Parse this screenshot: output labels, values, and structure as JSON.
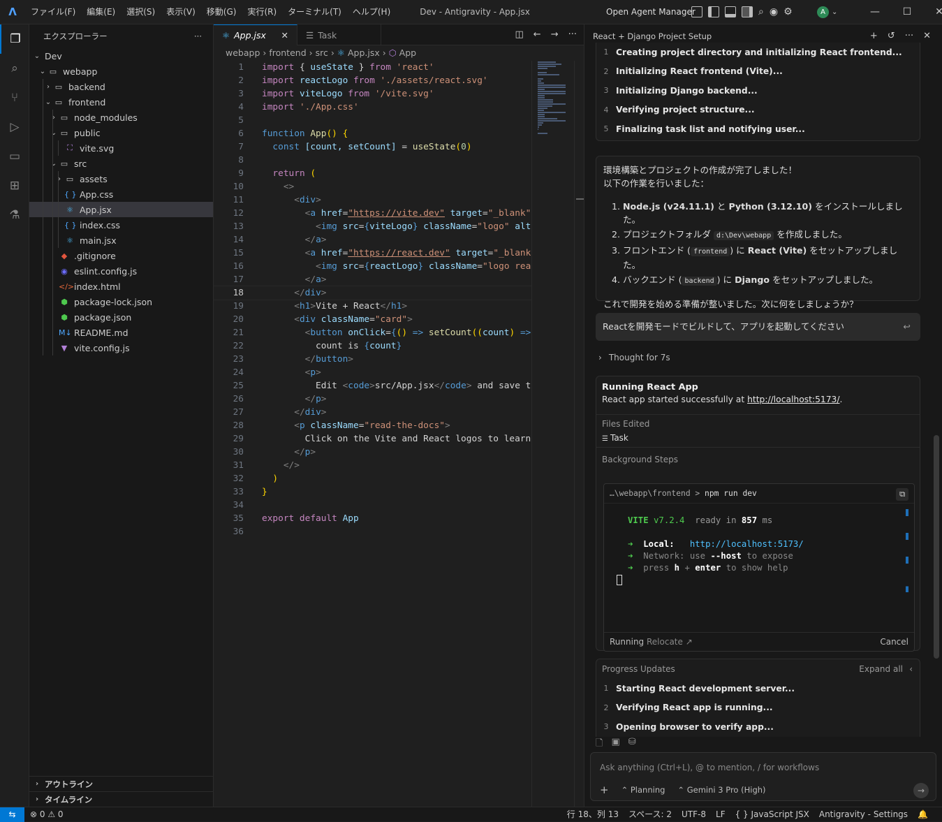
{
  "titlebar": {
    "menus": [
      "ファイル(F)",
      "編集(E)",
      "選択(S)",
      "表示(V)",
      "移動(G)",
      "実行(R)",
      "ターミナル(T)",
      "ヘルプ(H)"
    ],
    "title": "Dev - Antigravity - App.jsx",
    "agent_manager": "Open Agent Manager",
    "avatar": "A",
    "brand_color": "#0078d4"
  },
  "sidebar": {
    "title": "エクスプローラー",
    "root": "Dev",
    "items": [
      {
        "label": "webapp",
        "depth": 1,
        "chev": "v",
        "icon": "folder"
      },
      {
        "label": "backend",
        "depth": 2,
        "chev": ">",
        "icon": "folder"
      },
      {
        "label": "frontend",
        "depth": 2,
        "chev": "v",
        "icon": "folder"
      },
      {
        "label": "node_modules",
        "depth": 3,
        "chev": ">",
        "icon": "folder"
      },
      {
        "label": "public",
        "depth": 3,
        "chev": "v",
        "icon": "folder"
      },
      {
        "label": "vite.svg",
        "depth": 4,
        "chev": "",
        "icon": "svg"
      },
      {
        "label": "src",
        "depth": 3,
        "chev": "v",
        "icon": "folder"
      },
      {
        "label": "assets",
        "depth": 4,
        "chev": ">",
        "icon": "folder"
      },
      {
        "label": "App.css",
        "depth": 4,
        "chev": "",
        "icon": "css"
      },
      {
        "label": "App.jsx",
        "depth": 4,
        "chev": "",
        "icon": "react",
        "selected": true
      },
      {
        "label": "index.css",
        "depth": 4,
        "chev": "",
        "icon": "css"
      },
      {
        "label": "main.jsx",
        "depth": 4,
        "chev": "",
        "icon": "react"
      },
      {
        "label": ".gitignore",
        "depth": 3,
        "chev": "",
        "icon": "git"
      },
      {
        "label": "eslint.config.js",
        "depth": 3,
        "chev": "",
        "icon": "eslint"
      },
      {
        "label": "index.html",
        "depth": 3,
        "chev": "",
        "icon": "html"
      },
      {
        "label": "package-lock.json",
        "depth": 3,
        "chev": "",
        "icon": "npm"
      },
      {
        "label": "package.json",
        "depth": 3,
        "chev": "",
        "icon": "npm"
      },
      {
        "label": "README.md",
        "depth": 3,
        "chev": "",
        "icon": "md"
      },
      {
        "label": "vite.config.js",
        "depth": 3,
        "chev": "",
        "icon": "vite"
      }
    ],
    "outline": "アウトライン",
    "timeline": "タイムライン"
  },
  "editor": {
    "tabs": [
      {
        "label": "App.jsx",
        "active": true
      },
      {
        "label": "Task",
        "active": false
      }
    ],
    "breadcrumb": [
      "webapp",
      "frontend",
      "src",
      "App.jsx",
      "App"
    ],
    "current_line": 18,
    "lines": [
      [
        [
          "kw",
          "import "
        ],
        [
          "w",
          "{ "
        ],
        [
          "v",
          "useState"
        ],
        [
          "w",
          " } "
        ],
        [
          "kw",
          "from "
        ],
        [
          "s",
          "'react'"
        ]
      ],
      [
        [
          "kw",
          "import "
        ],
        [
          "v",
          "reactLogo "
        ],
        [
          "kw",
          "from "
        ],
        [
          "s",
          "'./assets/react.svg'"
        ]
      ],
      [
        [
          "kw",
          "import "
        ],
        [
          "v",
          "viteLogo "
        ],
        [
          "kw",
          "from "
        ],
        [
          "s",
          "'/vite.svg'"
        ]
      ],
      [
        [
          "kw",
          "import "
        ],
        [
          "s",
          "'./App.css'"
        ]
      ],
      [],
      [
        [
          "k",
          "function "
        ],
        [
          "f",
          "App"
        ],
        [
          "br",
          "() {"
        ]
      ],
      [
        [
          "w",
          "  "
        ],
        [
          "k",
          "const "
        ],
        [
          "v",
          "[count, setCount]"
        ],
        [
          "w",
          " = "
        ],
        [
          "f",
          "useState"
        ],
        [
          "br",
          "("
        ],
        [
          "n",
          "0"
        ],
        [
          "br",
          ")"
        ]
      ],
      [],
      [
        [
          "w",
          "  "
        ],
        [
          "kw",
          "return "
        ],
        [
          "br",
          "("
        ]
      ],
      [
        [
          "w",
          "    "
        ],
        [
          "p",
          "<>"
        ]
      ],
      [
        [
          "w",
          "      "
        ],
        [
          "p",
          "<"
        ],
        [
          "t",
          "div"
        ],
        [
          "p",
          ">"
        ]
      ],
      [
        [
          "w",
          "        "
        ],
        [
          "p",
          "<"
        ],
        [
          "t",
          "a "
        ],
        [
          "a",
          "href"
        ],
        [
          "w",
          "="
        ],
        [
          "u",
          "\"https://vite.dev\""
        ],
        [
          "w",
          " "
        ],
        [
          "a",
          "target"
        ],
        [
          "w",
          "="
        ],
        [
          "s",
          "\"_blank\""
        ]
      ],
      [
        [
          "w",
          "          "
        ],
        [
          "p",
          "<"
        ],
        [
          "t",
          "img "
        ],
        [
          "a",
          "src"
        ],
        [
          "w",
          "="
        ],
        [
          "k",
          "{"
        ],
        [
          "v",
          "viteLogo"
        ],
        [
          "k",
          "}"
        ],
        [
          "w",
          " "
        ],
        [
          "a",
          "className"
        ],
        [
          "w",
          "="
        ],
        [
          "s",
          "\"logo\""
        ],
        [
          "w",
          " "
        ],
        [
          "a",
          "alt"
        ]
      ],
      [
        [
          "w",
          "        "
        ],
        [
          "p",
          "</"
        ],
        [
          "t",
          "a"
        ],
        [
          "p",
          ">"
        ]
      ],
      [
        [
          "w",
          "        "
        ],
        [
          "p",
          "<"
        ],
        [
          "t",
          "a "
        ],
        [
          "a",
          "href"
        ],
        [
          "w",
          "="
        ],
        [
          "u",
          "\"https://react.dev\""
        ],
        [
          "w",
          " "
        ],
        [
          "a",
          "target"
        ],
        [
          "w",
          "="
        ],
        [
          "s",
          "\"_blank"
        ]
      ],
      [
        [
          "w",
          "          "
        ],
        [
          "p",
          "<"
        ],
        [
          "t",
          "img "
        ],
        [
          "a",
          "src"
        ],
        [
          "w",
          "="
        ],
        [
          "k",
          "{"
        ],
        [
          "v",
          "reactLogo"
        ],
        [
          "k",
          "}"
        ],
        [
          "w",
          " "
        ],
        [
          "a",
          "className"
        ],
        [
          "w",
          "="
        ],
        [
          "s",
          "\"logo rea"
        ]
      ],
      [
        [
          "w",
          "        "
        ],
        [
          "p",
          "</"
        ],
        [
          "t",
          "a"
        ],
        [
          "p",
          ">"
        ]
      ],
      [
        [
          "w",
          "      "
        ],
        [
          "p",
          "</"
        ],
        [
          "t",
          "div"
        ],
        [
          "p",
          ">"
        ]
      ],
      [
        [
          "w",
          "      "
        ],
        [
          "p",
          "<"
        ],
        [
          "t",
          "h1"
        ],
        [
          "p",
          ">"
        ],
        [
          "w",
          "Vite + React"
        ],
        [
          "p",
          "</"
        ],
        [
          "t",
          "h1"
        ],
        [
          "p",
          ">"
        ]
      ],
      [
        [
          "w",
          "      "
        ],
        [
          "p",
          "<"
        ],
        [
          "t",
          "div "
        ],
        [
          "a",
          "className"
        ],
        [
          "w",
          "="
        ],
        [
          "s",
          "\"card\""
        ],
        [
          "p",
          ">"
        ]
      ],
      [
        [
          "w",
          "        "
        ],
        [
          "p",
          "<"
        ],
        [
          "t",
          "button "
        ],
        [
          "a",
          "onClick"
        ],
        [
          "w",
          "="
        ],
        [
          "k",
          "{"
        ],
        [
          "br",
          "() "
        ],
        [
          "k",
          "=> "
        ],
        [
          "f",
          "setCount"
        ],
        [
          "br",
          "(("
        ],
        [
          "v",
          "count"
        ],
        [
          "br",
          ") "
        ],
        [
          "k",
          "=>"
        ]
      ],
      [
        [
          "w",
          "          count is "
        ],
        [
          "k",
          "{"
        ],
        [
          "v",
          "count"
        ],
        [
          "k",
          "}"
        ]
      ],
      [
        [
          "w",
          "        "
        ],
        [
          "p",
          "</"
        ],
        [
          "t",
          "button"
        ],
        [
          "p",
          ">"
        ]
      ],
      [
        [
          "w",
          "        "
        ],
        [
          "p",
          "<"
        ],
        [
          "t",
          "p"
        ],
        [
          "p",
          ">"
        ]
      ],
      [
        [
          "w",
          "          Edit "
        ],
        [
          "p",
          "<"
        ],
        [
          "t",
          "code"
        ],
        [
          "p",
          ">"
        ],
        [
          "w",
          "src/App.jsx"
        ],
        [
          "p",
          "</"
        ],
        [
          "t",
          "code"
        ],
        [
          "p",
          ">"
        ],
        [
          "w",
          " and save t"
        ]
      ],
      [
        [
          "w",
          "        "
        ],
        [
          "p",
          "</"
        ],
        [
          "t",
          "p"
        ],
        [
          "p",
          ">"
        ]
      ],
      [
        [
          "w",
          "      "
        ],
        [
          "p",
          "</"
        ],
        [
          "t",
          "div"
        ],
        [
          "p",
          ">"
        ]
      ],
      [
        [
          "w",
          "      "
        ],
        [
          "p",
          "<"
        ],
        [
          "t",
          "p "
        ],
        [
          "a",
          "className"
        ],
        [
          "w",
          "="
        ],
        [
          "s",
          "\"read-the-docs\""
        ],
        [
          "p",
          ">"
        ]
      ],
      [
        [
          "w",
          "        Click on the Vite and React logos to learn"
        ]
      ],
      [
        [
          "w",
          "      "
        ],
        [
          "p",
          "</"
        ],
        [
          "t",
          "p"
        ],
        [
          "p",
          ">"
        ]
      ],
      [
        [
          "w",
          "    "
        ],
        [
          "p",
          "</>"
        ]
      ],
      [
        [
          "w",
          "  "
        ],
        [
          "br",
          ")"
        ]
      ],
      [
        [
          "br",
          "}"
        ]
      ],
      [],
      [
        [
          "kw",
          "export default "
        ],
        [
          "v",
          "App"
        ]
      ],
      []
    ]
  },
  "agent": {
    "title": "React + Django Project Setup",
    "steps1": [
      "Creating project directory and initializing React frontend...",
      "Initializing React frontend (Vite)...",
      "Initializing Django backend...",
      "Verifying project structure...",
      "Finalizing task list and notifying user..."
    ],
    "msg_intro1": "環境構築とプロジェクトの作成が完了しました！",
    "msg_intro2": "以下の作業を行いました：",
    "list": {
      "l1a": "Node.js (v24.11.1)",
      "l1b": " と ",
      "l1c": "Python (3.12.10)",
      "l1d": " をインストールしました。",
      "l2a": "プロジェクトフォルダ ",
      "l2code": "d:\\Dev\\webapp",
      "l2b": " を作成しました。",
      "l3a": "フロントエンド (",
      "l3code": "frontend",
      "l3b": ") に ",
      "l3c": "React (Vite)",
      "l3d": " をセットアップしました。",
      "l4a": "バックエンド (",
      "l4code": "backend",
      "l4b": ") に ",
      "l4c": "Django",
      "l4d": " をセットアップしました。"
    },
    "msg_outro": "これで開発を始める準備が整いました。次に何をしましょうか？",
    "user_prompt": "Reactを開発モードでビルドして、アプリを起動してください",
    "thought": "Thought for 7s",
    "run_title": "Running React App",
    "run_text": "React app started successfully at ",
    "run_link": "http://localhost:5173/",
    "run_dot": ".",
    "files_edited": "Files Edited",
    "task_file": "Task",
    "bg_steps": "Background Steps",
    "term_path": "…\\webapp\\frontend",
    "term_cmd": "npm run dev",
    "term_vite": "VITE",
    "term_ver": "v7.2.4",
    "term_ready": "ready in ",
    "term_ms": "857",
    "term_msu": " ms",
    "term_local": "Local:",
    "term_url": "http://localhost:5173/",
    "term_net": "Network:",
    "term_net_t1": "use ",
    "term_net_t2": "--host",
    "term_net_t3": " to expose",
    "term_press": "press ",
    "term_h": "h",
    "term_plus": " + ",
    "term_enter": "enter",
    "term_help": " to show help",
    "running": "Running",
    "relocate": "Relocate",
    "cancel": "Cancel",
    "progress": "Progress Updates",
    "expand_all": "Expand all",
    "steps2": [
      "Starting React development server...",
      "Verifying React app is running...",
      "Opening browser to verify app..."
    ],
    "input_placeholder": "Ask anything (Ctrl+L), @ to mention, / for workflows",
    "mode": "Planning",
    "model": "Gemini 3 Pro (High)"
  },
  "statusbar": {
    "errors": "0",
    "warnings": "0",
    "position": "行 18、列 13",
    "spaces": "スペース: 2",
    "encoding": "UTF-8",
    "eol": "LF",
    "language": "JavaScript JSX",
    "settings": "Antigravity - Settings"
  }
}
